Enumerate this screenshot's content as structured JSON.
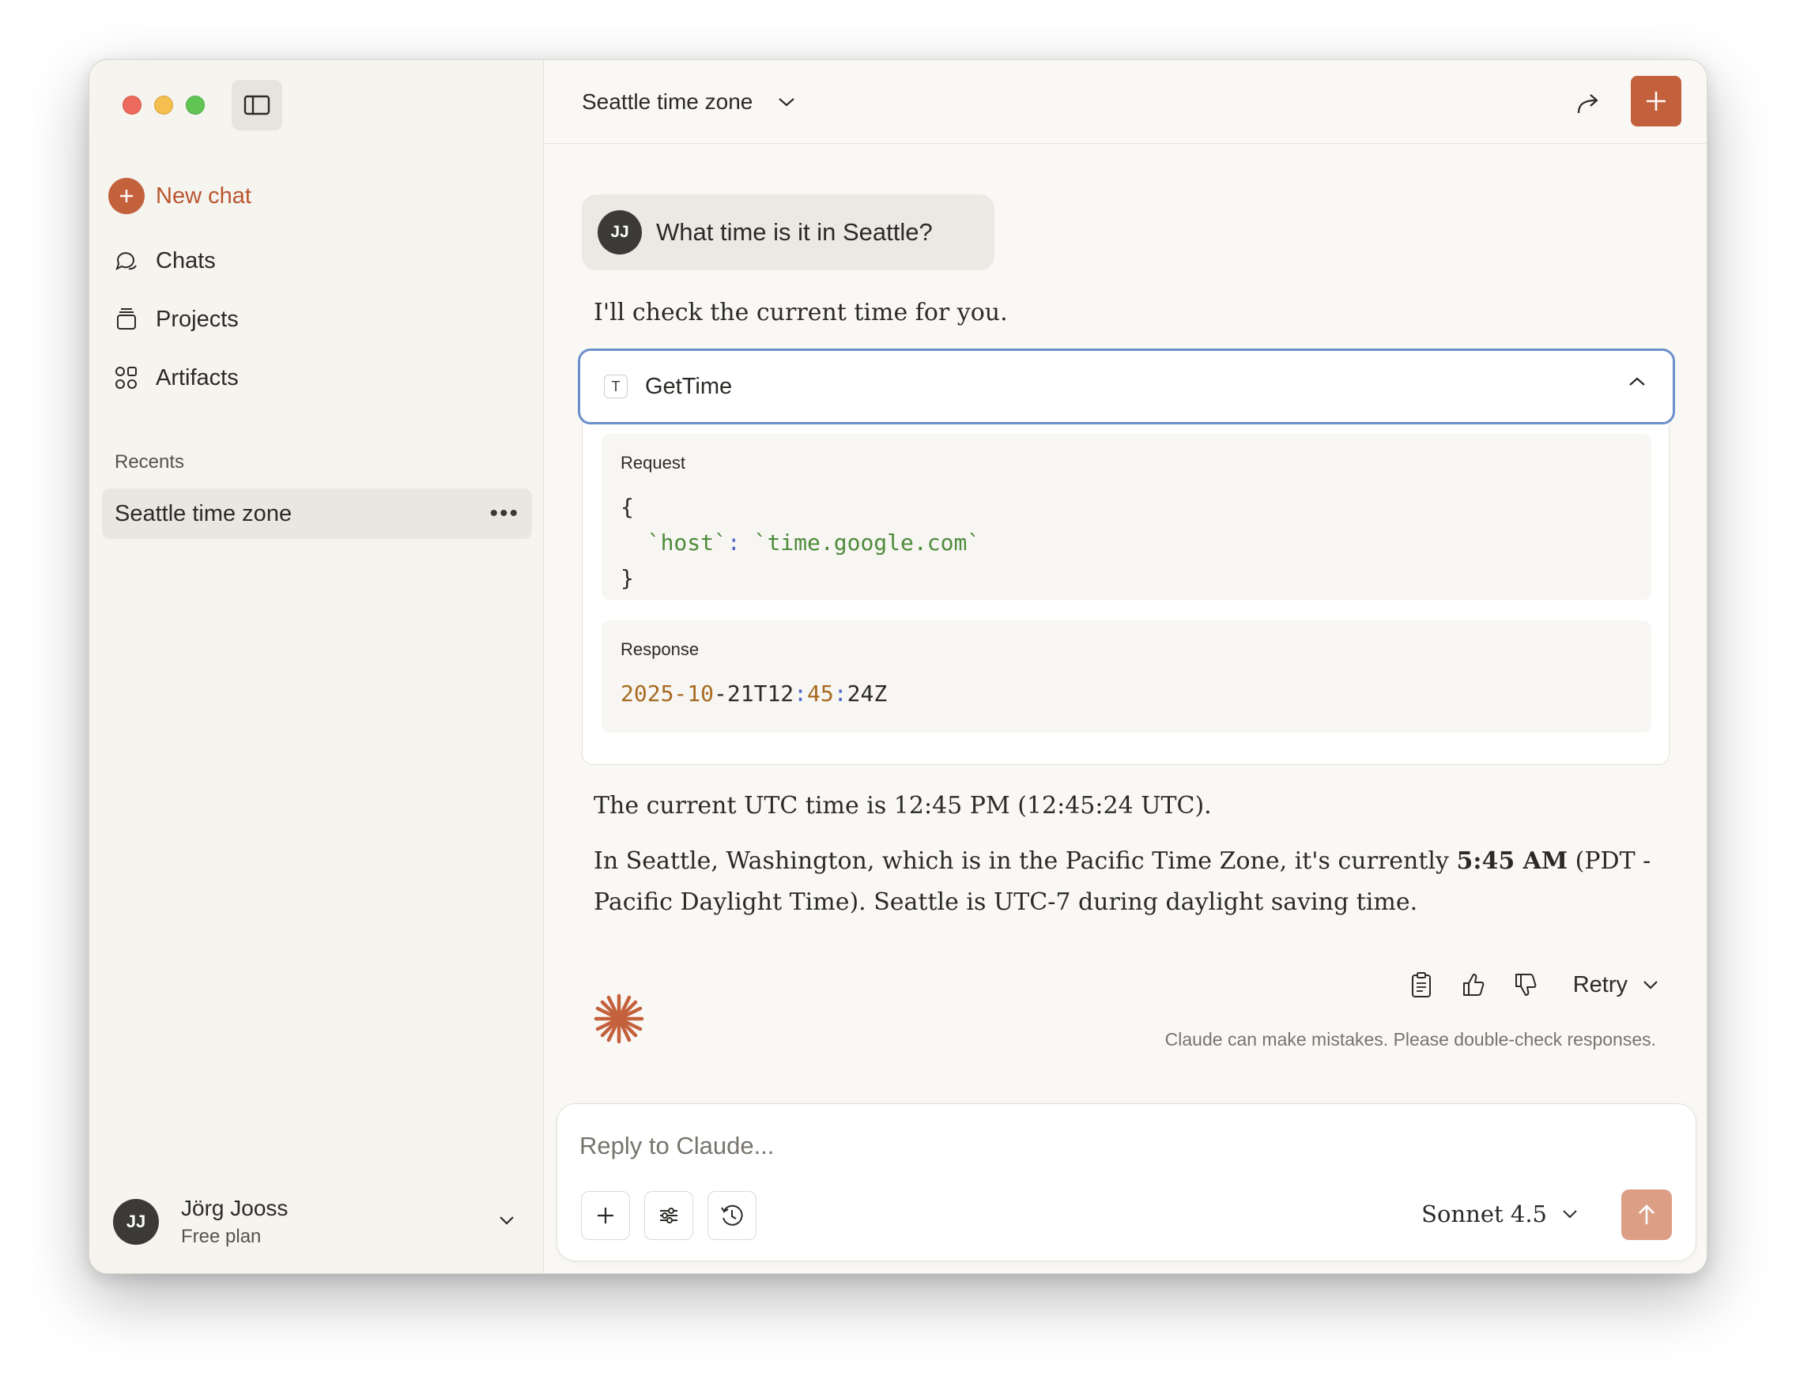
{
  "sidebar": {
    "new_chat": "New chat",
    "nav": [
      {
        "label": "Chats",
        "icon": "chat-bubbles-icon"
      },
      {
        "label": "Projects",
        "icon": "box-icon"
      },
      {
        "label": "Artifacts",
        "icon": "shapes-icon"
      }
    ],
    "recents_label": "Recents",
    "recents": [
      {
        "label": "Seattle time zone",
        "menu": "•••"
      }
    ],
    "user": {
      "initials": "JJ",
      "name": "Jörg Jooss",
      "plan": "Free plan"
    }
  },
  "header": {
    "title": "Seattle time zone"
  },
  "conversation": {
    "user_message": {
      "initials": "JJ",
      "text": "What time is it in Seattle?"
    },
    "assistant_intro": "I'll check the current time for you.",
    "tool": {
      "badge": "T",
      "name": "GetTime",
      "request_label": "Request",
      "request_open": "{",
      "request_key": "`host`",
      "request_colon": ":",
      "request_value": "`time.google.com`",
      "request_close": "}",
      "response_label": "Response",
      "response_date": "2025-10",
      "response_dash": "-21T12",
      "response_sep1": ":",
      "response_min": "45",
      "response_sep2": ":",
      "response_sec": "24Z"
    },
    "response_p1": "The current UTC time is 12:45 PM (12:45:24 UTC).",
    "response_p2_before": "In Seattle, Washington, which is in the Pacific Time Zone, it's currently ",
    "response_p2_bold": "5:45 AM",
    "response_p2_after": " (PDT - Pacific Daylight Time). Seattle is UTC-7 during daylight saving time.",
    "retry_label": "Retry",
    "disclaimer": "Claude can make mistakes. Please double-check responses."
  },
  "composer": {
    "placeholder": "Reply to Claude...",
    "model": "Sonnet 4.5"
  },
  "colors": {
    "accent": "#c4613d",
    "send_disabled": "#dc9f86",
    "tool_focus_border": "#6b8fcb"
  }
}
